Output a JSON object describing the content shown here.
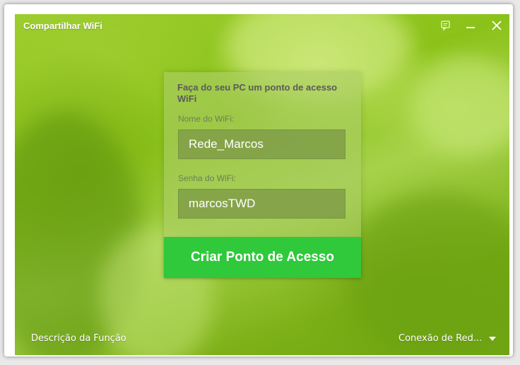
{
  "window": {
    "title": "Compartilhar WiFi"
  },
  "title_bar_icons": {
    "feedback": "feedback-icon",
    "minimize": "minimize-icon",
    "close": "close-icon"
  },
  "panel": {
    "heading": "Faça do seu PC um ponto de acesso WiFi",
    "wifi_name_label": "Nome do WiFi:",
    "wifi_name_value": "Rede_Marcos",
    "wifi_password_label": "Senha do WiFi:",
    "wifi_password_value": "marcosTWD",
    "create_button_label": "Criar Ponto de Acesso"
  },
  "footer": {
    "function_description_link": "Descrição da Função",
    "network_connection_label": "Conexão de Red..."
  },
  "colors": {
    "accent_button": "#2fc93b",
    "background_green": "#8bc219"
  }
}
